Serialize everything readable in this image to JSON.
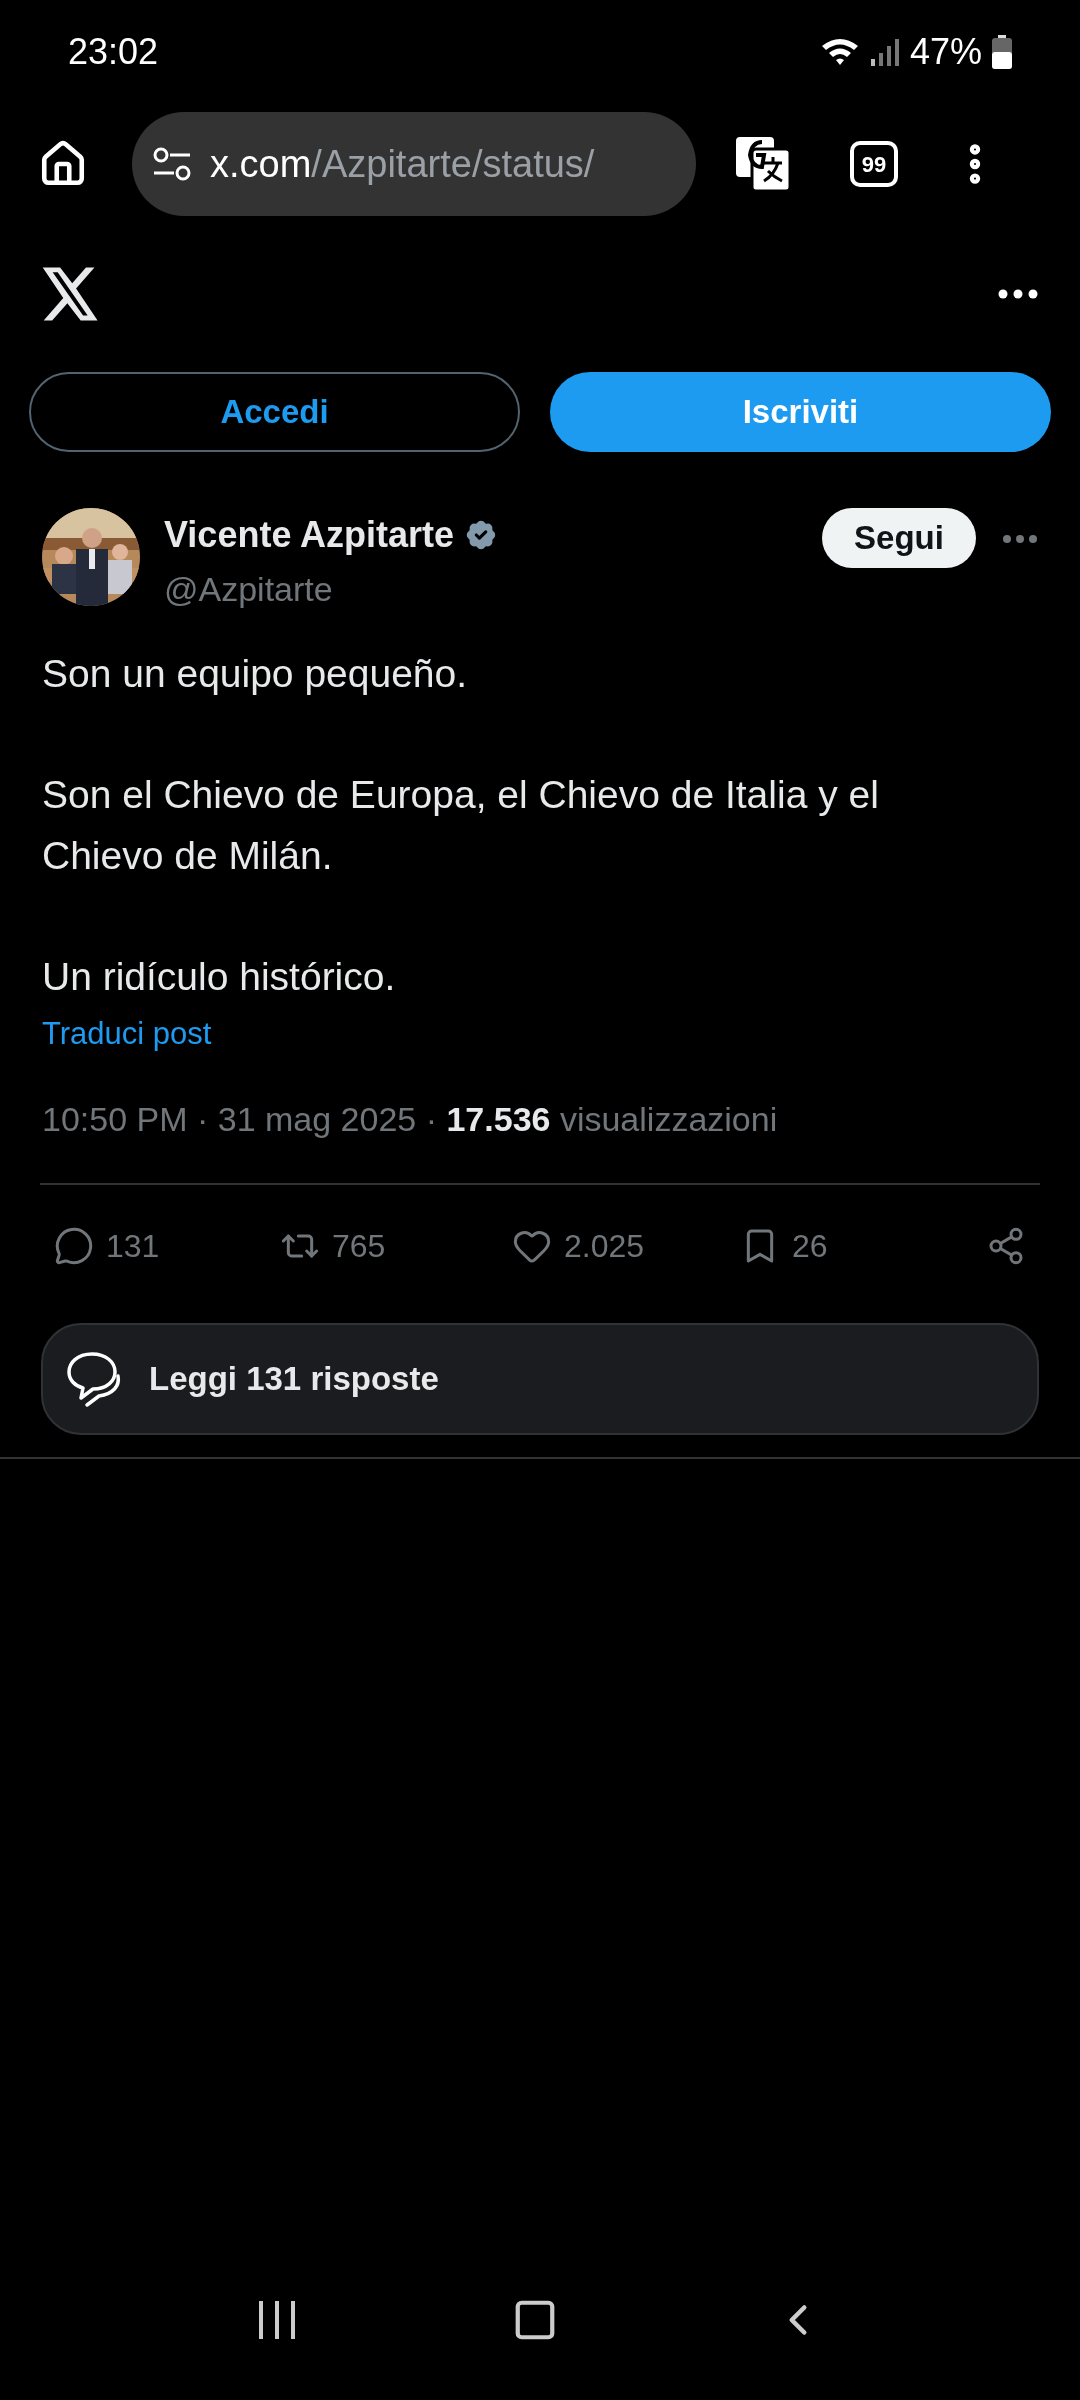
{
  "status_bar": {
    "time": "23:02",
    "battery": "47%"
  },
  "browser": {
    "url_domain": "x.com",
    "url_path": "/Azpitarte/status/",
    "tab_count": "99"
  },
  "auth_buttons": [
    {
      "label": "Accedi",
      "kind": "outline"
    },
    {
      "label": "Iscriviti",
      "kind": "filled"
    }
  ],
  "post": {
    "author": "Vicente Azpitarte",
    "verified": true,
    "handle": "@Azpitarte",
    "follow_label": "Segui",
    "paragraphs": [
      [
        "Son un equipo pequeño."
      ],
      [
        "Son el Chievo de Europa, el Chievo de Italia y el Chievo de Milán."
      ],
      [
        "Un ridículo histórico."
      ]
    ],
    "translate_link": "Traduci post",
    "meta": "10:50 PM · 31 mag 2025 · **17.536** visualizzazioni",
    "actions": [
      {
        "kind": "reply",
        "count": "131"
      },
      {
        "kind": "repost",
        "count": "765"
      },
      {
        "kind": "like",
        "count": "2.025"
      },
      {
        "kind": "bookmark",
        "count": "26"
      },
      {
        "kind": "share"
      }
    ],
    "read_replies": "Leggi 131 risposte"
  }
}
